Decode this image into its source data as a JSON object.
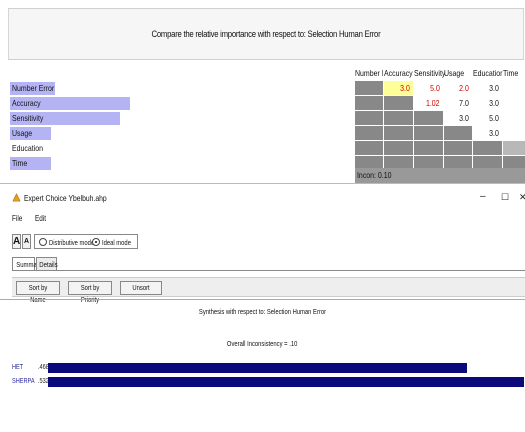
{
  "comparison": {
    "title": "Compare the relative importance with respect to: Selection Human Error",
    "columns": [
      "Number Err",
      "Accuracy",
      "Sensitivity",
      "Usage",
      "Education",
      "Time"
    ],
    "rows": [
      {
        "label": "Number Error",
        "importance": 0.13,
        "cells": [
          "",
          "3.0",
          "5.0",
          "2.0",
          "3.0",
          ""
        ]
      },
      {
        "label": "Accuracy",
        "importance": 0.35,
        "cells": [
          "",
          "",
          "1.02",
          "7.0",
          "3.0",
          ""
        ]
      },
      {
        "label": "Sensitivity",
        "importance": 0.32,
        "cells": [
          "",
          "",
          "",
          "3.0",
          "5.0",
          ""
        ]
      },
      {
        "label": "Usage",
        "importance": 0.12,
        "cells": [
          "",
          "",
          "",
          "",
          "3.0",
          ""
        ]
      },
      {
        "label": "Education",
        "importance": 0.0,
        "cells": [
          "",
          "",
          "",
          "",
          "",
          ""
        ]
      },
      {
        "label": "Time",
        "importance": 0.12,
        "cells": [
          "",
          "",
          "",
          "",
          "",
          ""
        ]
      }
    ],
    "inconsistency": "Incon: 0.10"
  },
  "window": {
    "title": "Expert Choice   Ybelbuh.ahp",
    "minimize": "–",
    "maximize": "☐",
    "close": "✕"
  },
  "menu": [
    "File",
    "Edit"
  ],
  "modes": {
    "distributive": "Distributive mode",
    "ideal": "Ideal mode",
    "selected": "ideal"
  },
  "tabs": [
    "Summary",
    "Details"
  ],
  "sort_buttons": [
    "Sort by Name",
    "Sort by Priority",
    "Unsort"
  ],
  "synthesis": {
    "title": "Synthesis with respect to: Selection Human Error",
    "inconsistency": "Overall Inconsistency = .10",
    "results": [
      {
        "name": "HET",
        "value": ".468",
        "fraction": 0.88
      },
      {
        "name": "SHERPA",
        "value": ".532",
        "fraction": 1.0
      }
    ]
  },
  "colors": {
    "importance_fill": "#b4b4f4",
    "result_bar": "#0a0a7a",
    "red_value": "#d00000",
    "highlight": "#ffff99"
  }
}
